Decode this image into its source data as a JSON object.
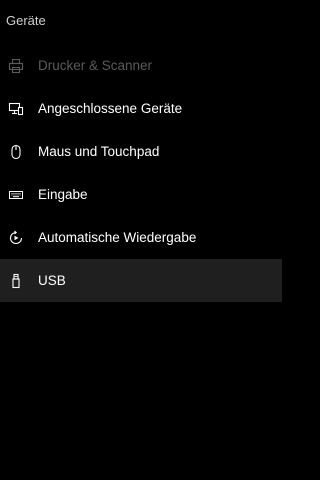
{
  "page": {
    "title": "Geräte"
  },
  "colors": {
    "background": "#000000",
    "text": "#ffffff",
    "disabled_text": "#5a5a5a",
    "selected_background": "#1f1f1f"
  },
  "nav": {
    "items": [
      {
        "label": "Drucker & Scanner",
        "icon": "printer-icon",
        "state": "disabled"
      },
      {
        "label": "Angeschlossene Geräte",
        "icon": "connected-devices-icon",
        "state": "normal"
      },
      {
        "label": "Maus und Touchpad",
        "icon": "mouse-icon",
        "state": "normal"
      },
      {
        "label": "Eingabe",
        "icon": "keyboard-icon",
        "state": "normal"
      },
      {
        "label": "Automatische Wiedergabe",
        "icon": "autoplay-icon",
        "state": "normal"
      },
      {
        "label": "USB",
        "icon": "usb-icon",
        "state": "selected"
      }
    ]
  }
}
